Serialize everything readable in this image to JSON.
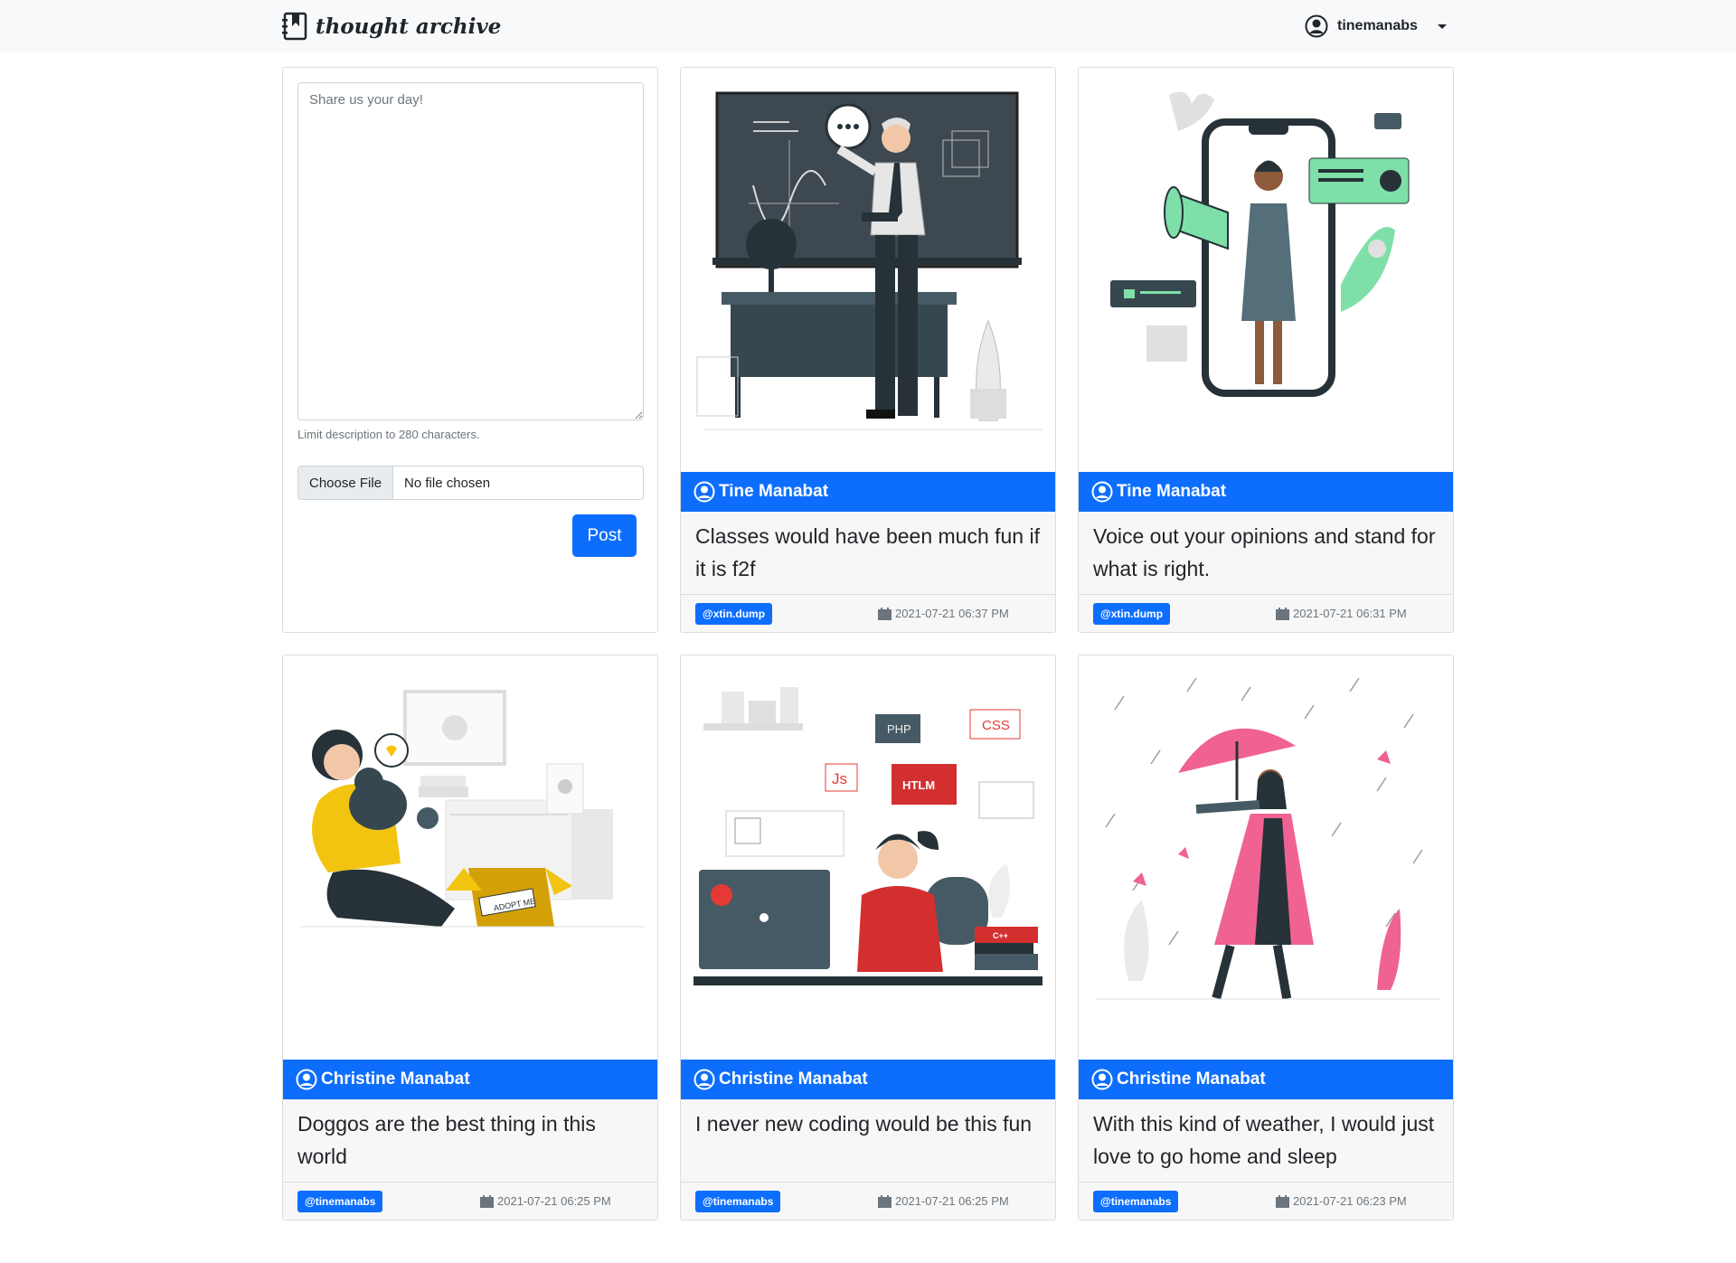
{
  "navbar": {
    "brand": "thought archive",
    "user": "tinemanabs"
  },
  "composer": {
    "placeholder": "Share us your day!",
    "helper": "Limit description to 280 characters.",
    "file_button": "Choose File",
    "file_name": "No file chosen",
    "post_button": "Post"
  },
  "posts": [
    {
      "author": "Tine Manabat",
      "text": "Classes would have been much fun if it is f2f",
      "tag": "@xtin.dump",
      "date": "2021-07-21 06:37 PM",
      "illustration": "teacher-at-chalkboard"
    },
    {
      "author": "Tine Manabat",
      "text": "Voice out your opinions and stand for what is right.",
      "tag": "@xtin.dump",
      "date": "2021-07-21 06:31 PM",
      "illustration": "woman-with-megaphone-in-phone"
    },
    {
      "author": "Christine Manabat",
      "text": "Doggos are the best thing in this world",
      "tag": "@tinemanabs",
      "date": "2021-07-21 06:25 PM",
      "illustration": "person-hugging-dog"
    },
    {
      "author": "Christine Manabat",
      "text": "I never new coding would be this fun",
      "tag": "@tinemanabs",
      "date": "2021-07-21 06:25 PM",
      "illustration": "woman-coding-at-computer",
      "illus_labels": {
        "php": "PHP",
        "css": "CSS",
        "js": "Js",
        "htlm": "HTLM",
        "cpp": "C++",
        "adopt": "ADOPT ME"
      }
    },
    {
      "author": "Christine Manabat",
      "text": "With this kind of weather, I would just love to go home and sleep",
      "tag": "@tinemanabs",
      "date": "2021-07-21 06:23 PM",
      "illustration": "woman-with-umbrella-in-rain"
    }
  ],
  "colors": {
    "primary": "#0d6efd",
    "navbar_bg": "#f8f9fa",
    "card_foot_bg": "#f7f7f7"
  }
}
